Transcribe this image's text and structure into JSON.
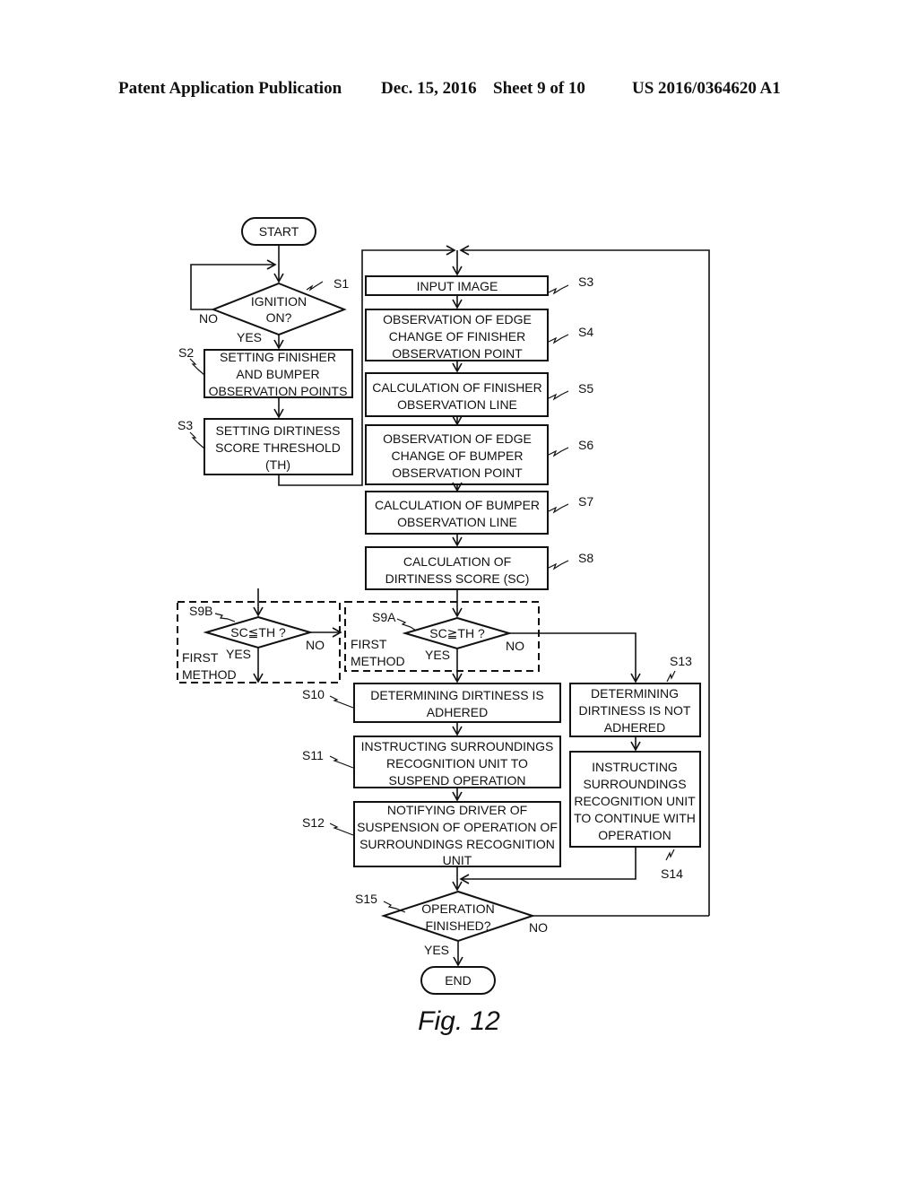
{
  "header": {
    "publication": "Patent Application Publication",
    "date": "Dec. 15, 2016",
    "sheet": "Sheet 9 of 10",
    "number": "US 2016/0364620 A1"
  },
  "figure_label": "Fig. 12",
  "terminals": {
    "start": "START",
    "end": "END"
  },
  "branch_labels": {
    "yes": "YES",
    "no": "NO"
  },
  "steps": {
    "s1": {
      "id": "S1",
      "lines": [
        "IGNITION",
        "ON?"
      ]
    },
    "s2": {
      "id": "S2",
      "lines": [
        "SETTING FINISHER",
        "AND BUMPER",
        "OBSERVATION POINTS"
      ]
    },
    "s3a": {
      "id": "S3",
      "lines": [
        "SETTING DIRTINESS",
        "SCORE THRESHOLD",
        "(TH)"
      ]
    },
    "s3b": {
      "id": "S3",
      "lines": [
        "INPUT IMAGE"
      ]
    },
    "s4": {
      "id": "S4",
      "lines": [
        "OBSERVATION OF EDGE",
        "CHANGE OF FINISHER",
        "OBSERVATION POINT"
      ]
    },
    "s5": {
      "id": "S5",
      "lines": [
        "CALCULATION OF FINISHER",
        "OBSERVATION LINE"
      ]
    },
    "s6": {
      "id": "S6",
      "lines": [
        "OBSERVATION OF EDGE",
        "CHANGE OF BUMPER",
        "OBSERVATION POINT"
      ]
    },
    "s7": {
      "id": "S7",
      "lines": [
        "CALCULATION OF BUMPER",
        "OBSERVATION LINE"
      ]
    },
    "s8": {
      "id": "S8",
      "lines": [
        "CALCULATION OF",
        "DIRTINESS SCORE (SC)"
      ]
    },
    "s9a": {
      "id": "S9A",
      "lines": [
        "SC≧TH ?"
      ],
      "method": [
        "FIRST",
        "METHOD"
      ]
    },
    "s9b": {
      "id": "S9B",
      "lines": [
        "SC≦TH ?"
      ],
      "method": [
        "FIRST",
        "METHOD"
      ]
    },
    "s10": {
      "id": "S10",
      "lines": [
        "DETERMINING DIRTINESS IS",
        "ADHERED"
      ]
    },
    "s11": {
      "id": "S11",
      "lines": [
        "INSTRUCTING SURROUNDINGS",
        "RECOGNITION UNIT TO",
        "SUSPEND OPERATION"
      ]
    },
    "s12": {
      "id": "S12",
      "lines": [
        "NOTIFYING DRIVER OF",
        "SUSPENSION OF OPERATION OF",
        "SURROUNDINGS RECOGNITION",
        "UNIT"
      ]
    },
    "s13": {
      "id": "S13",
      "lines": [
        "DETERMINING",
        "DIRTINESS IS NOT",
        "ADHERED"
      ]
    },
    "s14": {
      "id": "S14",
      "lines": [
        "INSTRUCTING",
        "SURROUNDINGS",
        "RECOGNITION UNIT",
        "TO CONTINUE WITH",
        "OPERATION"
      ]
    },
    "s15": {
      "id": "S15",
      "lines": [
        "OPERATION",
        "FINISHED?"
      ]
    }
  }
}
